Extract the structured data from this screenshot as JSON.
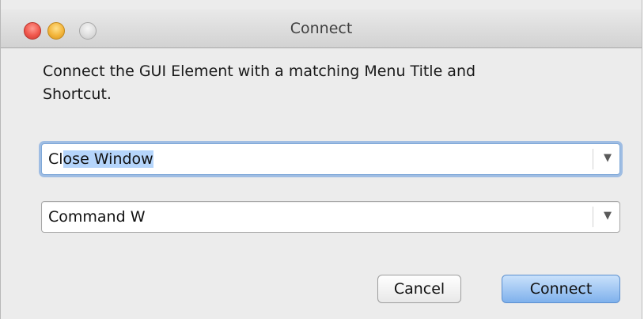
{
  "window": {
    "title": "Connect"
  },
  "instruction": {
    "line1": "Connect the GUI Element with a matching Menu Title and",
    "line2": "Shortcut."
  },
  "menu_title_combo": {
    "value_unselected": "Cl",
    "value_selected": "ose Window",
    "arrow": "▼"
  },
  "shortcut_combo": {
    "value": "Command W",
    "arrow": "▼"
  },
  "buttons": {
    "cancel_label": "Cancel",
    "connect_label": "Connect"
  },
  "colors": {
    "close": "#f0574c",
    "minimize": "#f3b53b",
    "zoom": "#dcdcdc",
    "focus_ring": "#6098dc",
    "selection": "#b5d5fb",
    "default_button": "#7fb1ec"
  }
}
